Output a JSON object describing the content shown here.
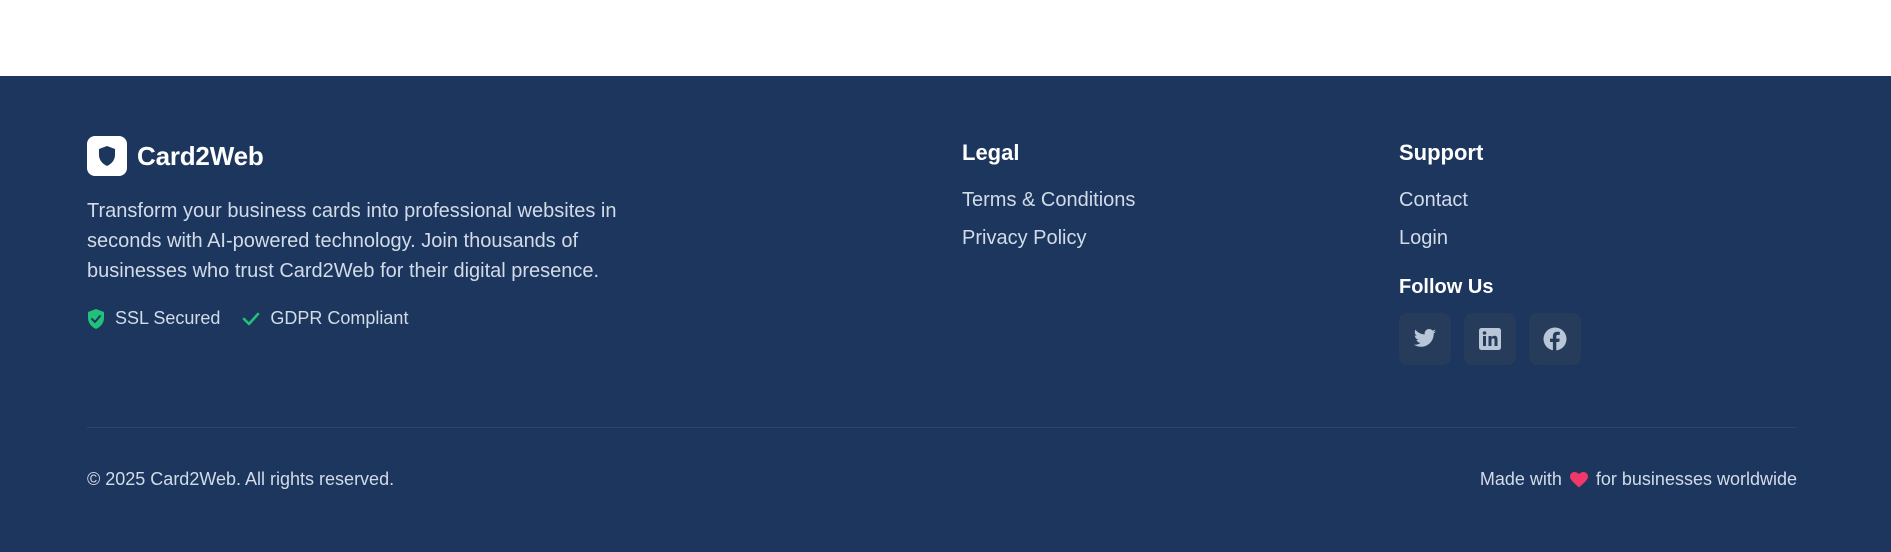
{
  "brand": {
    "name": "Card2Web",
    "logo_icon": "shield-icon",
    "description": "Transform your business cards into professional websites in seconds with AI-powered technology. Join thousands of businesses who trust Card2Web for their digital presence."
  },
  "badges": [
    {
      "label": "SSL Secured",
      "icon": "shield-check-icon",
      "color": "#22c17a"
    },
    {
      "label": "GDPR Compliant",
      "icon": "check-icon",
      "color": "#22c17a"
    }
  ],
  "legal": {
    "title": "Legal",
    "links": [
      "Terms & Conditions",
      "Privacy Policy"
    ]
  },
  "support": {
    "title": "Support",
    "links": [
      "Contact",
      "Login"
    ],
    "follow_title": "Follow Us",
    "social": [
      "twitter-icon",
      "linkedin-icon",
      "facebook-icon"
    ]
  },
  "bottom": {
    "copyright": "© 2025 Card2Web. All rights reserved.",
    "made_with_prefix": "Made with",
    "made_with_suffix": "for businesses worldwide",
    "heart_icon": "heart-icon"
  },
  "colors": {
    "footer_bg": "#1c365e",
    "accent_green": "#22c17a",
    "heart": "#f2386b"
  }
}
